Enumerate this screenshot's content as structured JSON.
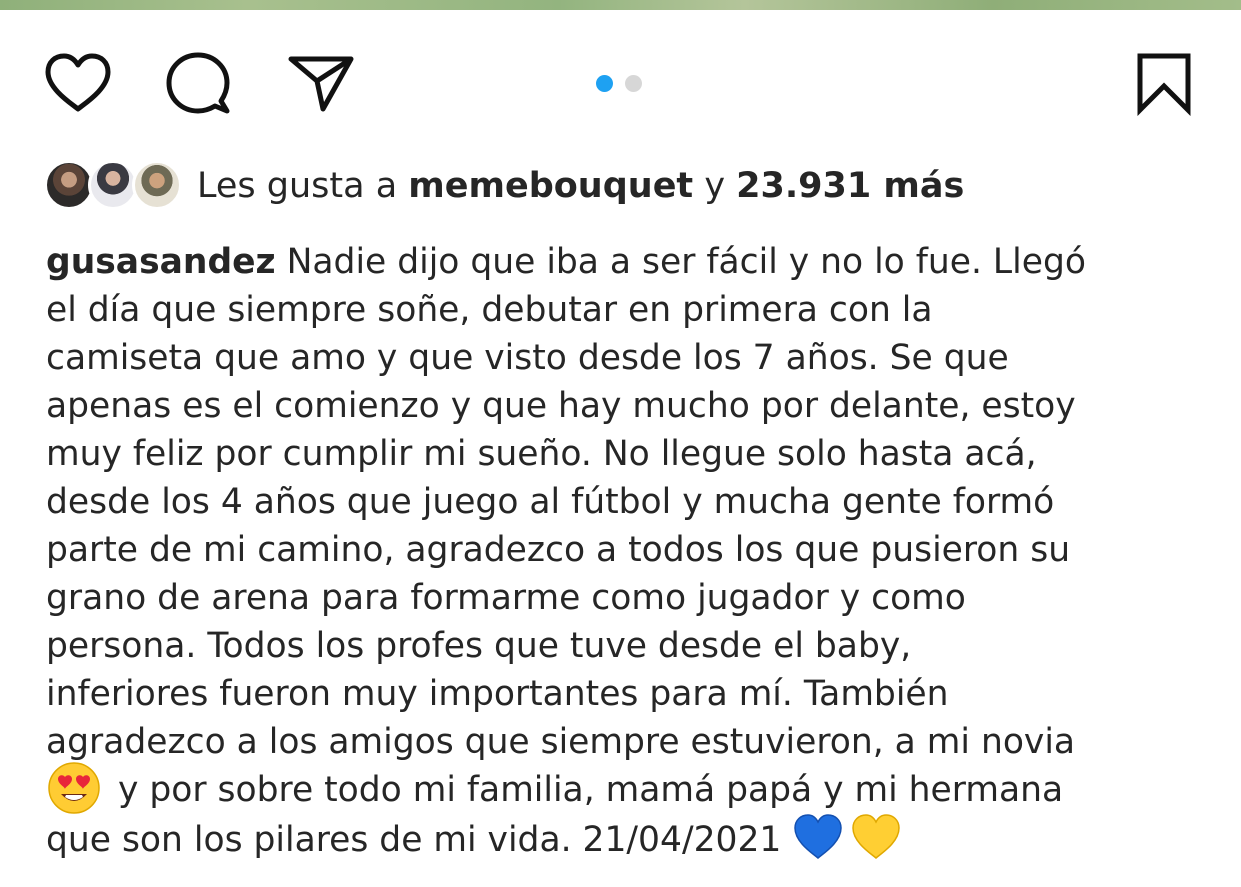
{
  "post": {
    "actions": {
      "like_icon": "heart-icon",
      "comment_icon": "comment-bubble-icon",
      "share_icon": "paper-plane-icon",
      "save_icon": "bookmark-icon"
    },
    "carousel": {
      "count": 2,
      "active_index": 0,
      "active_color": "#1ea1f2",
      "inactive_color": "#d7d7d7"
    },
    "likes": {
      "prefix": "Les gusta a",
      "user": "memebouquet",
      "connector": "y",
      "count": "23.931 más"
    },
    "caption": {
      "username": "gusasandez",
      "lines": [
        "Nadie dijo que iba a ser fácil y no lo fue. Llegó",
        "el día que siempre soñe, debutar en primera con la",
        "camiseta que amo y que visto desde los 7 años. Se que",
        "apenas es el comienzo y que hay mucho por delante, estoy",
        "muy feliz por cumplir mi sueño. No llegue solo hasta acá,",
        "desde los 4 años que juego al fútbol y mucha gente formó",
        "parte de mi camino, agradezco a todos los que pusieron su",
        "grano de arena para formarme como jugador y como",
        "persona. Todos los profes que tuve desde el baby,",
        "inferiores fueron muy importantes para mí. También",
        "agradezco a los amigos que siempre estuvieron, a mi novia",
        "y por sobre todo mi familia, mamá papá y mi hermana",
        "que son los pilares de mi vida. 21/04/2021"
      ],
      "emojis": [
        "heart-eyes-emoji",
        "blue-heart-emoji",
        "yellow-heart-emoji"
      ]
    }
  }
}
